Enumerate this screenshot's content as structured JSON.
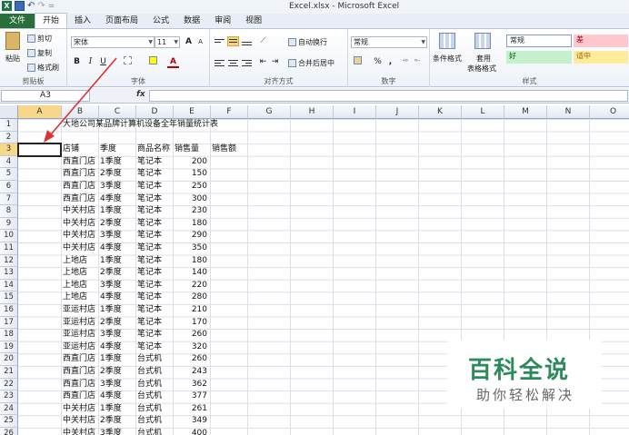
{
  "window": {
    "title": "Excel.xlsx - Microsoft Excel",
    "qat_separator": "="
  },
  "tabs": [
    "文件",
    "开始",
    "插入",
    "页面布局",
    "公式",
    "数据",
    "审阅",
    "视图"
  ],
  "ribbon": {
    "clipboard": {
      "label": "剪贴板",
      "paste": "粘贴",
      "cut": "剪切",
      "copy": "复制",
      "format_painter": "格式刷"
    },
    "font": {
      "label": "字体",
      "font_name": "宋体",
      "font_size": "11",
      "bold": "B",
      "italic": "I",
      "underline": "U",
      "grow": "A",
      "shrink": "A"
    },
    "alignment": {
      "label": "对齐方式",
      "wrap_text": "自动换行",
      "merge_center": "合并后居中"
    },
    "number": {
      "label": "数字",
      "format": "常规",
      "percent": "%",
      "comma": ","
    },
    "styles": {
      "label": "样式",
      "conditional": "条件格式",
      "table_format_1": "套用",
      "table_format_2": "表格格式",
      "normal": "常规",
      "bad": "差",
      "good": "好",
      "neutral": "适中"
    }
  },
  "formula_bar": {
    "name_box": "A3",
    "fx": "fx",
    "value": ""
  },
  "columns": [
    "A",
    "B",
    "C",
    "D",
    "E",
    "F",
    "G",
    "H",
    "I",
    "J",
    "K",
    "L",
    "M",
    "N",
    "O"
  ],
  "rows": [
    "1",
    "2",
    "3",
    "4",
    "5",
    "6",
    "7",
    "8",
    "9",
    "10",
    "11",
    "12",
    "13",
    "14",
    "15",
    "16",
    "17",
    "18",
    "19",
    "20",
    "21",
    "22",
    "23",
    "24",
    "25",
    "26"
  ],
  "sheet": {
    "title": "大地公司某品牌计算机设备全年销量统计表",
    "headers": [
      "店铺",
      "季度",
      "商品名称",
      "销售量",
      "销售额"
    ],
    "records": [
      [
        "西直门店",
        "1季度",
        "笔记本",
        "200"
      ],
      [
        "西直门店",
        "2季度",
        "笔记本",
        "150"
      ],
      [
        "西直门店",
        "3季度",
        "笔记本",
        "250"
      ],
      [
        "西直门店",
        "4季度",
        "笔记本",
        "300"
      ],
      [
        "中关村店",
        "1季度",
        "笔记本",
        "230"
      ],
      [
        "中关村店",
        "2季度",
        "笔记本",
        "180"
      ],
      [
        "中关村店",
        "3季度",
        "笔记本",
        "290"
      ],
      [
        "中关村店",
        "4季度",
        "笔记本",
        "350"
      ],
      [
        "上地店",
        "1季度",
        "笔记本",
        "180"
      ],
      [
        "上地店",
        "2季度",
        "笔记本",
        "140"
      ],
      [
        "上地店",
        "3季度",
        "笔记本",
        "220"
      ],
      [
        "上地店",
        "4季度",
        "笔记本",
        "280"
      ],
      [
        "亚运村店",
        "1季度",
        "笔记本",
        "210"
      ],
      [
        "亚运村店",
        "2季度",
        "笔记本",
        "170"
      ],
      [
        "亚运村店",
        "3季度",
        "笔记本",
        "260"
      ],
      [
        "亚运村店",
        "4季度",
        "笔记本",
        "320"
      ],
      [
        "西直门店",
        "1季度",
        "台式机",
        "260"
      ],
      [
        "西直门店",
        "2季度",
        "台式机",
        "243"
      ],
      [
        "西直门店",
        "3季度",
        "台式机",
        "362"
      ],
      [
        "西直门店",
        "4季度",
        "台式机",
        "377"
      ],
      [
        "中关村店",
        "1季度",
        "台式机",
        "261"
      ],
      [
        "中关村店",
        "2季度",
        "台式机",
        "349"
      ],
      [
        "中关村店",
        "3季度",
        "台式机",
        "400"
      ]
    ]
  },
  "watermark": {
    "main": "百科全说",
    "sub": "助你轻松解决"
  },
  "colors": {
    "annotation_arrow": "#e03030",
    "file_tab": "#2a6e3a",
    "selected_header": "#f7d88a"
  }
}
